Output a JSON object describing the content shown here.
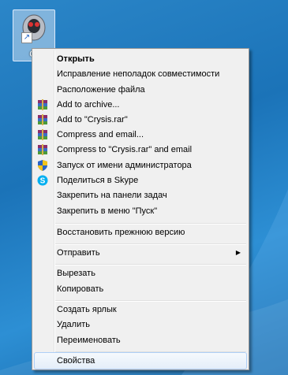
{
  "desktop": {
    "icon_label": "Cr"
  },
  "menu": {
    "items": [
      {
        "label": "Открыть"
      },
      {
        "label": "Исправление неполадок совместимости"
      },
      {
        "label": "Расположение файла"
      },
      {
        "label": "Add to archive...",
        "icon": "winrar-icon"
      },
      {
        "label": "Add to \"Crysis.rar\"",
        "icon": "winrar-icon"
      },
      {
        "label": "Compress and email...",
        "icon": "winrar-icon"
      },
      {
        "label": "Compress to \"Crysis.rar\" and email",
        "icon": "winrar-icon"
      },
      {
        "label": "Запуск от имени администратора",
        "icon": "uac-shield-icon"
      },
      {
        "label": "Поделиться в Skype",
        "icon": "skype-icon"
      },
      {
        "label": "Закрепить на панели задач"
      },
      {
        "label": "Закрепить в меню \"Пуск\""
      },
      {
        "label": "Восстановить прежнюю версию"
      },
      {
        "label": "Отправить"
      },
      {
        "label": "Вырезать"
      },
      {
        "label": "Копировать"
      },
      {
        "label": "Создать ярлык"
      },
      {
        "label": "Удалить"
      },
      {
        "label": "Переименовать"
      },
      {
        "label": "Свойства"
      }
    ]
  },
  "colors": {
    "winrar": "#8b2d6b",
    "skype": "#00aff0",
    "shield_blue": "#2a63c6",
    "shield_yellow": "#f2c31a"
  }
}
